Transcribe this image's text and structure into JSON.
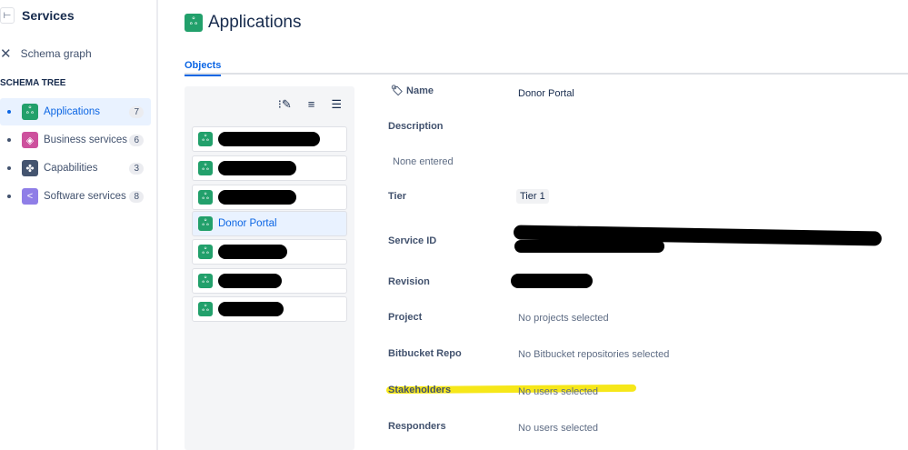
{
  "sidebar": {
    "title": "Services",
    "schema_graph": "Schema graph",
    "tree_label": "SCHEMA TREE",
    "items": [
      {
        "label": "Applications",
        "count": "7",
        "color": "#22a06b"
      },
      {
        "label": "Business services",
        "count": "6",
        "color": "#cd519d"
      },
      {
        "label": "Capabilities",
        "count": "3",
        "color": "#44546f"
      },
      {
        "label": "Software services",
        "count": "8",
        "color": "#8f7ee7"
      }
    ]
  },
  "main": {
    "title": "Applications",
    "tab": "Objects",
    "selected_object": "Donor Portal"
  },
  "details": {
    "name_label": "Name",
    "name_value": "Donor Portal",
    "description_label": "Description",
    "description_value": "None entered",
    "tier_label": "Tier",
    "tier_value": "Tier 1",
    "service_id_label": "Service ID",
    "revision_label": "Revision",
    "project_label": "Project",
    "project_value": "No projects selected",
    "bitbucket_label": "Bitbucket Repo",
    "bitbucket_value": "No Bitbucket repositories selected",
    "stakeholders_label": "Stakeholders",
    "stakeholders_value": "No users selected",
    "responders_label": "Responders",
    "responders_value": "No users selected"
  }
}
